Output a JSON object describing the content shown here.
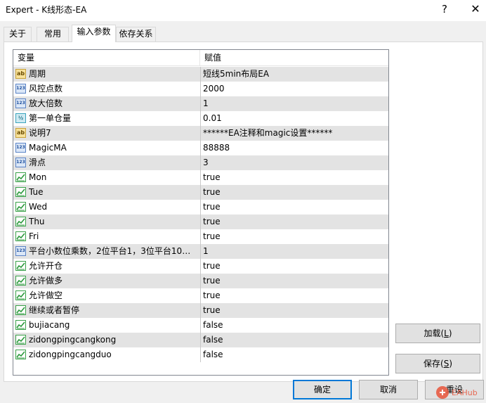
{
  "window": {
    "title": "Expert - K线形态-EA",
    "help_glyph": "?",
    "close_glyph": "✕"
  },
  "tabs": [
    {
      "label": "关于"
    },
    {
      "label": "常用"
    },
    {
      "label": "输入参数"
    },
    {
      "label": "依存关系"
    }
  ],
  "grid": {
    "col_variable": "变量",
    "col_value": "赋值",
    "rows": [
      {
        "type": "ab",
        "type_glyph": "ab",
        "name": "周期",
        "value": "短线5min布局EA"
      },
      {
        "type": "num",
        "type_glyph": "123",
        "name": "风控点数",
        "value": "2000"
      },
      {
        "type": "num",
        "type_glyph": "123",
        "name": "放大倍数",
        "value": "1"
      },
      {
        "type": "frac",
        "type_glyph": "½",
        "name": "第一单仓量",
        "value": "0.01"
      },
      {
        "type": "ab",
        "type_glyph": "ab",
        "name": "说明7",
        "value": "******EA注释和magic设置******"
      },
      {
        "type": "num",
        "type_glyph": "123",
        "name": "MagicMA",
        "value": "88888"
      },
      {
        "type": "num",
        "type_glyph": "123",
        "name": "滑点",
        "value": "3"
      },
      {
        "type": "bool",
        "name": "Mon",
        "value": "true"
      },
      {
        "type": "bool",
        "name": "Tue",
        "value": "true"
      },
      {
        "type": "bool",
        "name": "Wed",
        "value": "true"
      },
      {
        "type": "bool",
        "name": "Thu",
        "value": "true"
      },
      {
        "type": "bool",
        "name": "Fri",
        "value": "true"
      },
      {
        "type": "num",
        "type_glyph": "123",
        "name": "平台小数位乘数，2位平台1，3位平台10（?...",
        "value": "1"
      },
      {
        "type": "bool",
        "name": "允许开仓",
        "value": "true"
      },
      {
        "type": "bool",
        "name": "允许做多",
        "value": "true"
      },
      {
        "type": "bool",
        "name": "允许做空",
        "value": "true"
      },
      {
        "type": "bool",
        "name": "继续或者暂停",
        "value": "true"
      },
      {
        "type": "bool",
        "name": "bujiacang",
        "value": "false"
      },
      {
        "type": "bool",
        "name": "zidongpingcangkong",
        "value": "false"
      },
      {
        "type": "bool",
        "name": "zidongpingcangduo",
        "value": "false"
      }
    ]
  },
  "buttons": {
    "load": {
      "text": "加载(",
      "key": "L",
      "close": ")"
    },
    "save": {
      "text": "保存(",
      "key": "S",
      "close": ")"
    },
    "ok": "确定",
    "cancel": "取消",
    "reset": "重设"
  },
  "watermark": {
    "text": "EAHub",
    "color": "#e8533a"
  }
}
